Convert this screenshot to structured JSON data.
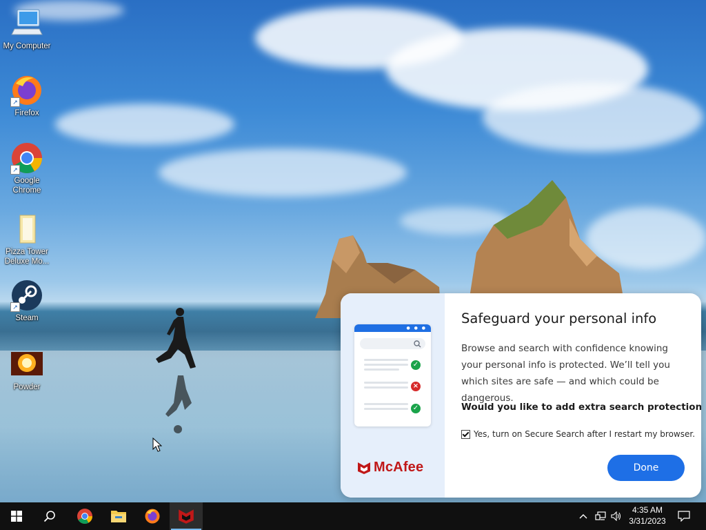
{
  "desktop": {
    "icons": [
      {
        "label": "My Computer",
        "icon": "computer-icon"
      },
      {
        "label": "Firefox",
        "icon": "firefox-icon"
      },
      {
        "label": "Google Chrome",
        "icon": "chrome-icon"
      },
      {
        "label": "Pizza Tower Deluxe Mo...",
        "icon": "folder-icon"
      },
      {
        "label": "Steam",
        "icon": "steam-icon"
      },
      {
        "label": "Powder",
        "icon": "powder-icon"
      }
    ]
  },
  "popup": {
    "title": "Safeguard your personal info",
    "body": "Browse and search with confidence knowing your personal info is protected. We’ll tell you which sites are safe — and which could be dangerous.",
    "question": "Would you like to add extra search protection?",
    "checkbox_label": "Yes, turn on Secure Search after I restart my browser.",
    "checkbox_checked": true,
    "done_label": "Done",
    "brand": "McAfee",
    "colors": {
      "accent": "#1e6fe6",
      "brand": "#c01818",
      "panel": "#e6effb"
    }
  },
  "taskbar": {
    "items": [
      "start-icon",
      "search-icon",
      "chrome-icon",
      "file-explorer-icon",
      "firefox-icon",
      "mcafee-icon"
    ],
    "active": "mcafee-icon",
    "time": "4:35 AM",
    "date": "3/31/2023"
  }
}
